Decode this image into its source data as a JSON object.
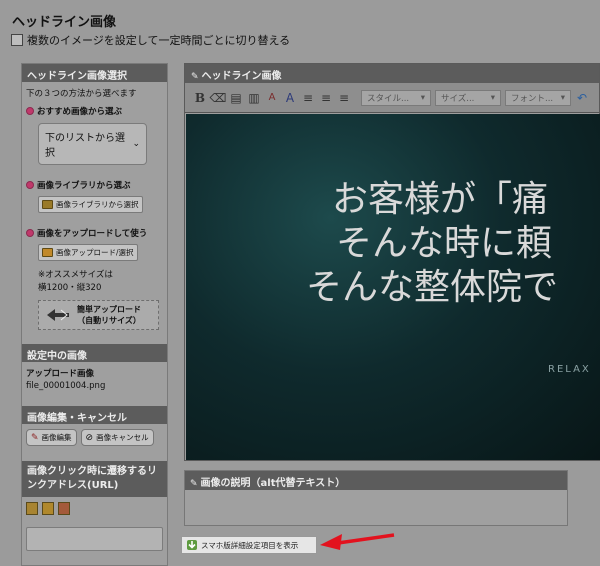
{
  "page": {
    "title": "ヘッドライン画像",
    "rotate_label": "複数のイメージを設定して一定時間ごとに切り替える"
  },
  "select_panel": {
    "header": "ヘッドライン画像選択",
    "intro": "下の３つの方法から選べます",
    "option1_title": "おすすめ画像から選ぶ",
    "option1_select": "下のリストから選択",
    "option2_title": "画像ライブラリから選ぶ",
    "option2_button": "画像ライブラリから選択",
    "option3_title": "画像をアップロードして使う",
    "option3_button": "画像アップロード/選択",
    "size_note_1": "※オススメサイズは",
    "size_note_2": "横1200・縦320",
    "easy_upload_1": "簡単アップロード",
    "easy_upload_2": "（自動リサイズ）"
  },
  "current_panel": {
    "header": "設定中の画像",
    "label": "アップロード画像",
    "filename": "file_00001004.png"
  },
  "edit_panel": {
    "header": "画像編集・キャンセル",
    "edit_button": "画像編集",
    "cancel_button": "画像キャンセル"
  },
  "link_panel": {
    "header": "画像クリック時に遷移するリンクアドレス(URL)",
    "url_value": ""
  },
  "editor": {
    "header": "ヘッドライン画像",
    "style_dropdown": "スタイル...",
    "size_dropdown": "サイズ...",
    "font_dropdown": "フォント...",
    "hero_line1": "お客様が「痛",
    "hero_line2": "そんな時に頼",
    "hero_line3": "そんな整体院で",
    "hero_small": "RELAX"
  },
  "alt_panel": {
    "header": "画像の説明（alt代替テキスト）"
  },
  "smartphone_button": "スマホ版詳細設定項目を表示",
  "colors": {
    "arrow": "#e3121e",
    "header_bg": "#5c5c5c",
    "option_dot": "#c0396b"
  }
}
